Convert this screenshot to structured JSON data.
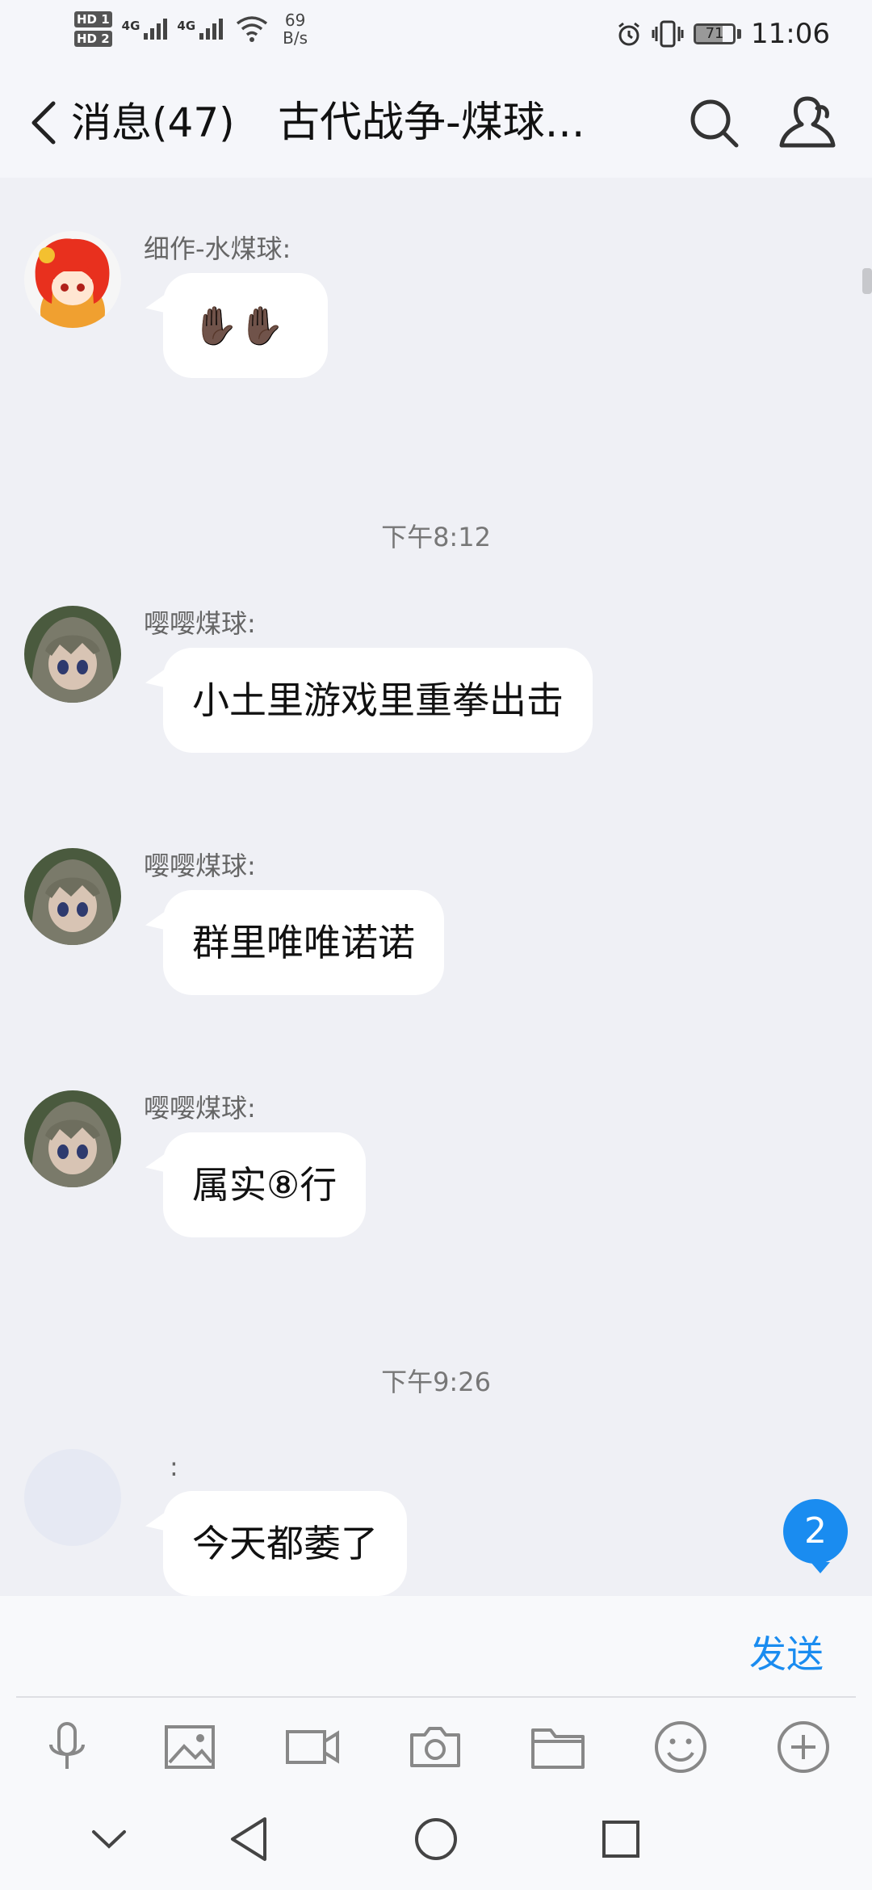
{
  "status_bar": {
    "hd1": "HD 1",
    "hd2": "HD 2",
    "net1": "4G",
    "net2": "4G",
    "speed_value": "69",
    "speed_unit": "B/s",
    "battery": "71",
    "time": "11:06"
  },
  "header": {
    "back_label": "消息(47)",
    "title": "古代战争-煤球..."
  },
  "messages": [
    {
      "sender": "细作-水煤球:",
      "text": "✋🏿✋🏿"
    },
    {
      "sender": "嘤嘤煤球:",
      "text": "小土里游戏里重拳出击"
    },
    {
      "sender": "嘤嘤煤球:",
      "text": "群里唯唯诺诺"
    },
    {
      "sender": "嘤嘤煤球:",
      "text": "属实⑧行"
    },
    {
      "sender": ":",
      "text": "今天都萎了"
    }
  ],
  "timestamps": [
    "下午8:12",
    "下午9:26"
  ],
  "unread_badge": "2",
  "input": {
    "placeholder": "",
    "send_label": "发送"
  },
  "colors": {
    "accent": "#1a8cf0",
    "background": "#eff0f5",
    "bubble": "#ffffff"
  },
  "toolbar_icons": [
    "microphone-icon",
    "image-icon",
    "video-icon",
    "camera-icon",
    "folder-icon",
    "emoji-icon",
    "plus-icon"
  ],
  "nav_icons": [
    "collapse-icon",
    "back-triangle-icon",
    "home-circle-icon",
    "recent-square-icon"
  ]
}
